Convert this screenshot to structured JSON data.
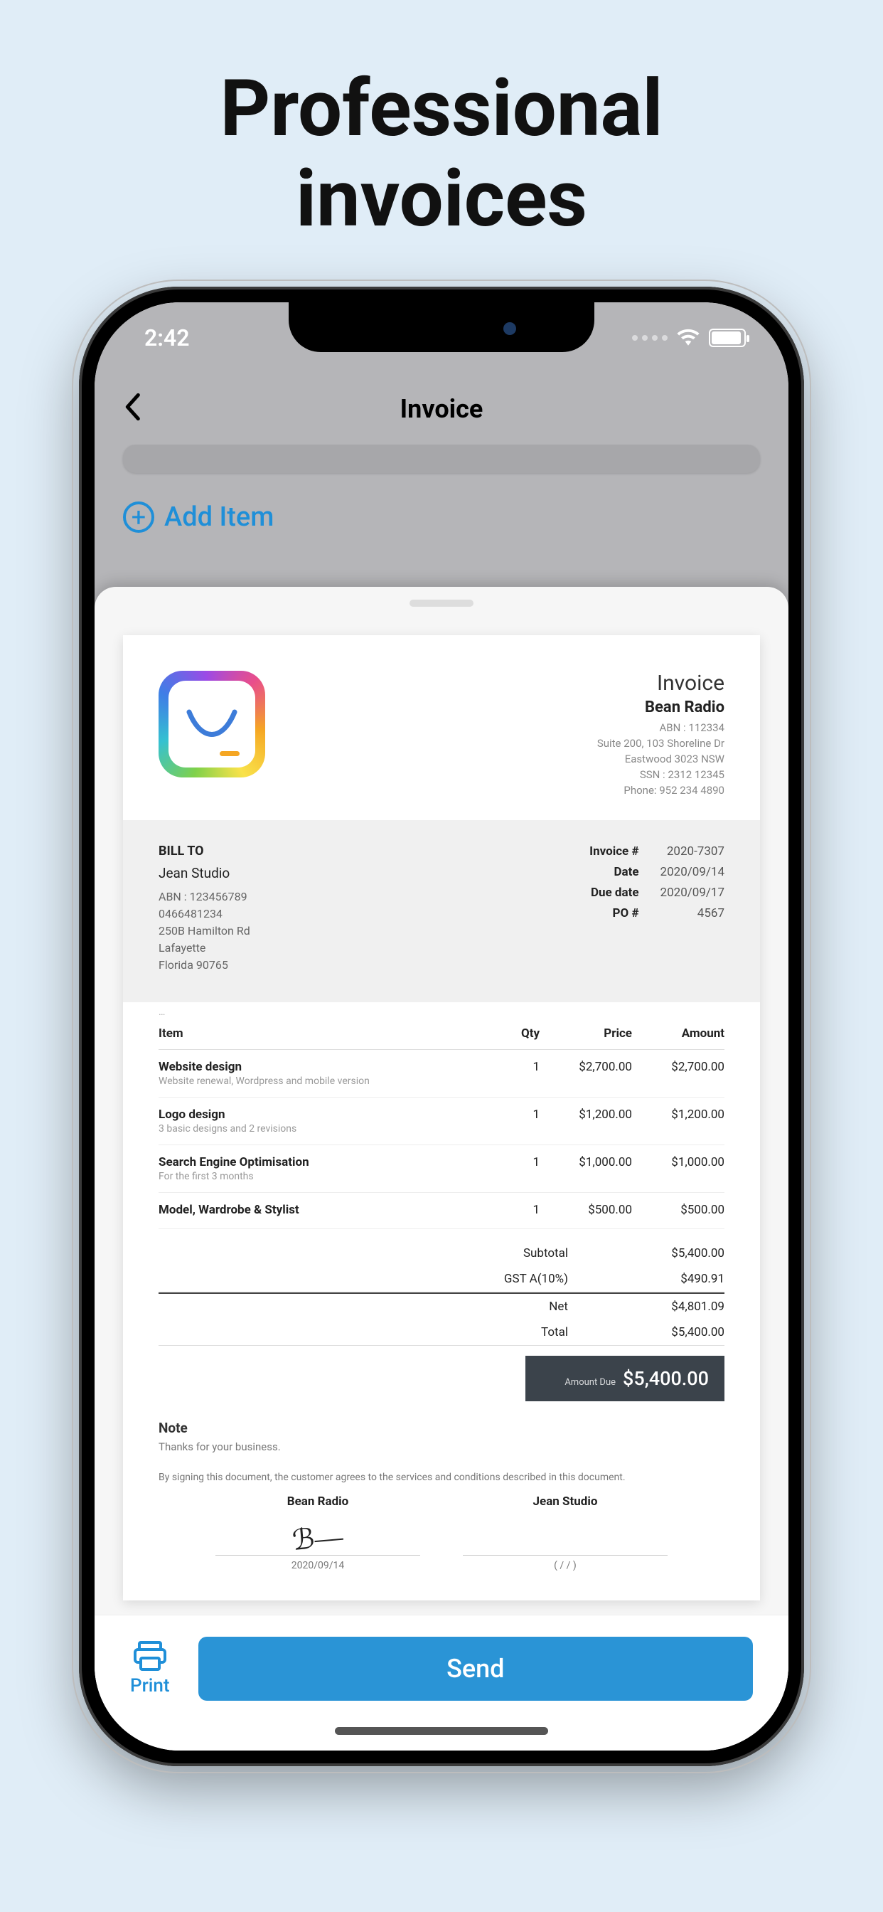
{
  "hero": {
    "title_line1": "Professional",
    "title_line2": "invoices"
  },
  "status": {
    "time": "2:42"
  },
  "nav": {
    "title": "Invoice"
  },
  "under": {
    "add_item": "Add Item"
  },
  "invoice": {
    "doc_title": "Invoice",
    "company_name": "Bean Radio",
    "company_meta": {
      "abn": "ABN : 112334",
      "addr1": "Suite 200, 103 Shoreline Dr",
      "addr2": "Eastwood 3023 NSW",
      "ssn": "SSN : 2312 12345",
      "phone": "Phone: 952 234 4890"
    },
    "bill_to_label": "BILL TO",
    "bill_to": {
      "name": "Jean Studio",
      "abn": "ABN : 123456789",
      "phone": "0466481234",
      "addr1": "250B Hamilton Rd",
      "addr2": "Lafayette",
      "addr3": "Florida 90765"
    },
    "meta_keys": {
      "invno": "Invoice #",
      "date": "Date",
      "due": "Due date",
      "po": "PO #"
    },
    "meta_vals": {
      "invno": "2020-7307",
      "date": "2020/09/14",
      "due": "2020/09/17",
      "po": "4567"
    },
    "columns": {
      "item": "Item",
      "qty": "Qty",
      "price": "Price",
      "amount": "Amount"
    },
    "items": [
      {
        "name": "Website design",
        "desc": "Website renewal, Wordpress and mobile version",
        "qty": "1",
        "price": "$2,700.00",
        "amount": "$2,700.00"
      },
      {
        "name": "Logo design",
        "desc": "3 basic designs and 2 revisions",
        "qty": "1",
        "price": "$1,200.00",
        "amount": "$1,200.00"
      },
      {
        "name": "Search Engine Optimisation",
        "desc": "For the first 3 months",
        "qty": "1",
        "price": "$1,000.00",
        "amount": "$1,000.00"
      },
      {
        "name": "Model, Wardrobe & Stylist",
        "desc": "",
        "qty": "1",
        "price": "$500.00",
        "amount": "$500.00"
      }
    ],
    "totals": {
      "subtotal_label": "Subtotal",
      "subtotal": "$5,400.00",
      "tax_label": "GST A(10%)",
      "tax": "$490.91",
      "net_label": "Net",
      "net": "$4,801.09",
      "total_label": "Total",
      "total": "$5,400.00",
      "amount_due_label": "Amount Due",
      "amount_due": "$5,400.00"
    },
    "note_title": "Note",
    "note_body": "Thanks for your business.",
    "disclaimer": "By signing this document, the customer agrees to the services and conditions described in this document.",
    "sign": {
      "left_name": "Bean Radio",
      "left_date": "2020/09/14",
      "right_name": "Jean Studio",
      "right_date": "(     /     /     )"
    }
  },
  "footer": {
    "print": "Print",
    "send": "Send"
  }
}
